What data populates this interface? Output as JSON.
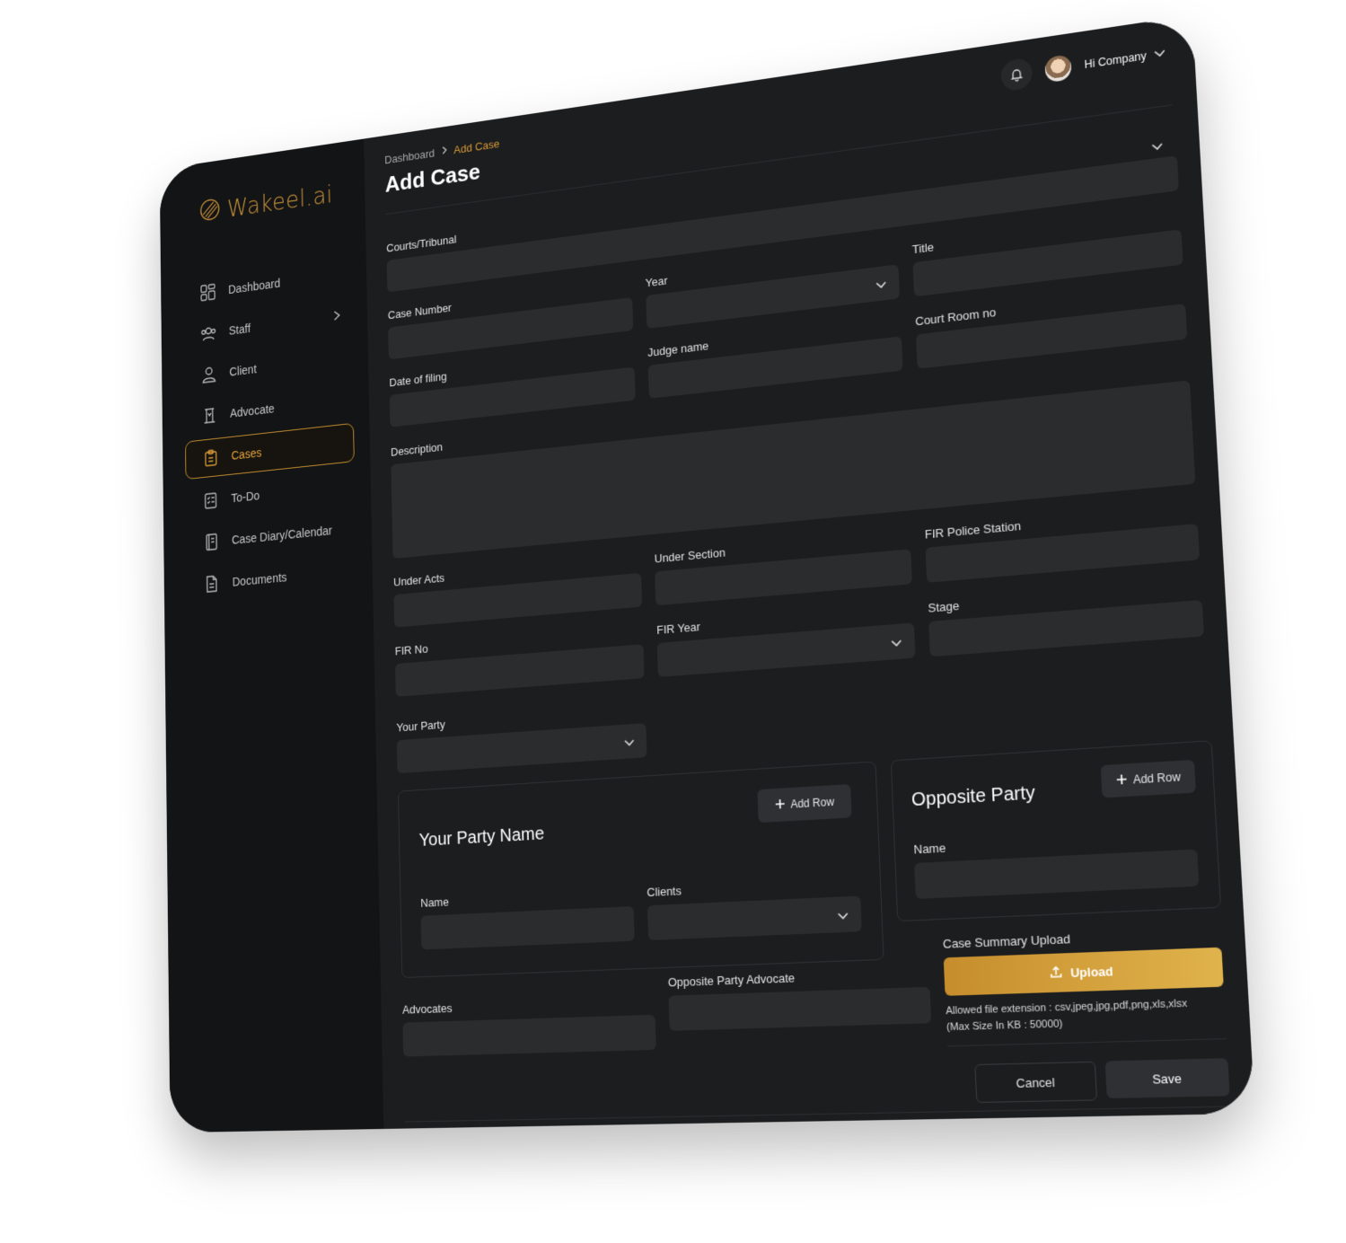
{
  "app": {
    "logo_text": "Wakeel.ai"
  },
  "sidebar": {
    "items": [
      {
        "label": "Dashboard",
        "icon": "grid-icon"
      },
      {
        "label": "Staff",
        "icon": "users-icon"
      },
      {
        "label": "Client",
        "icon": "user-icon"
      },
      {
        "label": "Advocate",
        "icon": "advocate-icon"
      },
      {
        "label": "Cases",
        "icon": "clipboard-icon"
      },
      {
        "label": "To-Do",
        "icon": "checklist-icon"
      },
      {
        "label": "Case Diary/Calendar",
        "icon": "diary-icon"
      },
      {
        "label": "Documents",
        "icon": "document-icon"
      }
    ],
    "active": "Cases"
  },
  "header": {
    "breadcrumb": {
      "root": "Dashboard",
      "current": "Add Case"
    },
    "title": "Add Case",
    "user": "Hi Company"
  },
  "form": {
    "courts": "Courts/Tribunal",
    "case_number": "Case Number",
    "year": "Year",
    "title": "Title",
    "date_of_filing": "Date of filing",
    "judge_name": "Judge name",
    "court_room": "Court Room no",
    "description": "Description",
    "under_acts": "Under Acts",
    "under_section": "Under Section",
    "fir_station": "FIR Police Station",
    "fir_no": "FIR No",
    "fir_year": "FIR Year",
    "stage": "Stage",
    "your_party": "Your Party"
  },
  "your_party_box": {
    "title": "Your Party Name",
    "add_row": "Add Row",
    "name": "Name",
    "clients": "Clients"
  },
  "opposite_party_box": {
    "title": "Opposite Party",
    "add_row": "Add Row",
    "name": "Name"
  },
  "advocates": "Advocates",
  "opposite_party_advocate": "Opposite Party Advocate",
  "upload": {
    "label": "Case Summary Upload",
    "button": "Upload",
    "hint_ext": "Allowed file extension : csv,jpeg,jpg,pdf,png,xls,xlsx",
    "hint_size": "(Max Size In KB : 50000)"
  },
  "actions": {
    "cancel": "Cancel",
    "save": "Save"
  },
  "colors": {
    "accent": "#d89a33",
    "bg": "#1c1d1f",
    "sidebar": "#131415",
    "field": "#2a2c2e"
  }
}
